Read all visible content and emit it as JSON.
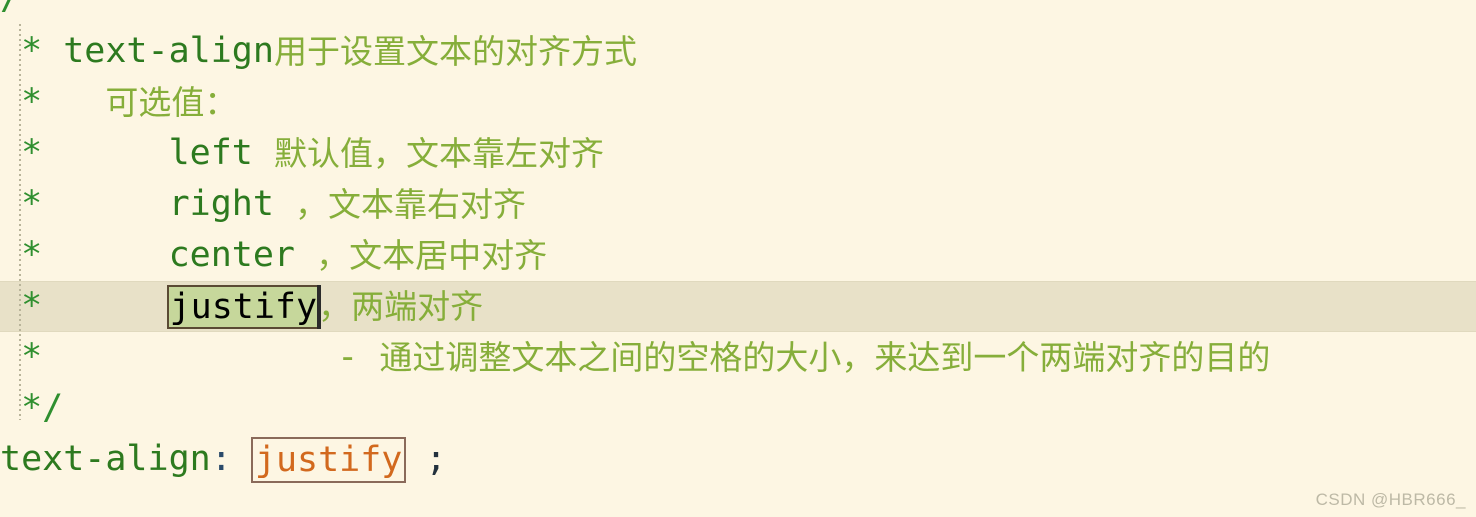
{
  "editor": {
    "background_color": "#fdf6e3",
    "active_line_color": "#e8e1c8",
    "comment_color": "#2f8f2f",
    "cjk_comment_color": "#86ae3a",
    "value_color": "#d2691e",
    "occurrence_highlight_color": "#c6d79b"
  },
  "lines": [
    {
      "id": "line-open-comment",
      "lead": "/*",
      "code": "",
      "cjk": ""
    },
    {
      "id": "line-title",
      "lead": " * ",
      "code": "text-align",
      "cjk": "用于设置文本的对齐方式"
    },
    {
      "id": "line-options-label",
      "lead": " *   ",
      "code": "",
      "cjk": "可选值："
    },
    {
      "id": "line-left",
      "lead": " *      ",
      "code": "left ",
      "cjk": "默认值，文本靠左对齐"
    },
    {
      "id": "line-right",
      "lead": " *      ",
      "code": "right ",
      "cjk": "，文本靠右对齐"
    },
    {
      "id": "line-center",
      "lead": " *      ",
      "code": "center ",
      "cjk": "，文本居中对齐"
    },
    {
      "id": "line-justify",
      "lead": " *      ",
      "code": "justify",
      "cjk": "，两端对齐",
      "active": true,
      "highlighted_token": "justify"
    },
    {
      "id": "line-justify-detail",
      "lead": " *              ",
      "dash": "- ",
      "cjk": "通过调整文本之间的空格的大小，来达到一个两端对齐的目的"
    },
    {
      "id": "line-close-comment",
      "lead": " */",
      "code": "",
      "cjk": ""
    },
    {
      "id": "line-declaration",
      "property": "text-align",
      "colon": ": ",
      "value": "justify",
      "semicolon": " ;"
    }
  ],
  "watermark": {
    "text": "CSDN @HBR666_"
  }
}
